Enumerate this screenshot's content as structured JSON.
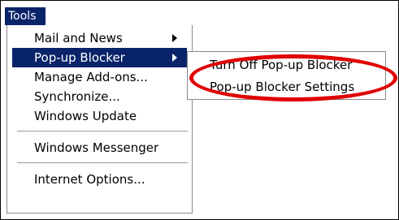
{
  "menubar": {
    "tools_label": "Tools"
  },
  "menu": {
    "items": [
      {
        "label": "Mail and News"
      },
      {
        "label": "Pop-up Blocker"
      },
      {
        "label": "Manage Add-ons..."
      },
      {
        "label": "Synchronize..."
      },
      {
        "label": "Windows Update"
      },
      {
        "label": "Windows Messenger"
      },
      {
        "label": "Internet Options..."
      }
    ]
  },
  "submenu": {
    "items": [
      {
        "label": "Turn Off Pop-up Blocker"
      },
      {
        "label": "Pop-up Blocker Settings"
      }
    ]
  },
  "colors": {
    "highlight": "#0a246a",
    "annotation": "#e00000"
  }
}
